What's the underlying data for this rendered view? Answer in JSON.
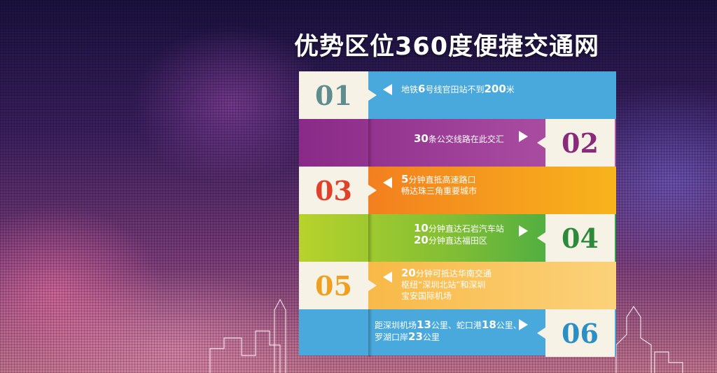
{
  "title": "优势区位360度便捷交通网",
  "rows": [
    {
      "num": "01",
      "num_color": "#5f8c8e",
      "lines": [
        [
          "地铁",
          "6",
          "号线官田站不到",
          "200",
          "米"
        ]
      ]
    },
    {
      "num": "02",
      "num_color": "#8a2a7a",
      "lines": [
        [
          "",
          "30",
          "条公交线路在此交汇"
        ]
      ]
    },
    {
      "num": "03",
      "num_color": "#e0412a",
      "lines": [
        [
          "",
          "5",
          "分钟直抵高速路口"
        ],
        [
          "畅达珠三角重要城市"
        ]
      ]
    },
    {
      "num": "04",
      "num_color": "#2d8a3a",
      "lines": [
        [
          "",
          "10",
          "分钟直达石岩汽车站"
        ],
        [
          "",
          "20",
          "分钟直达福田区"
        ]
      ]
    },
    {
      "num": "05",
      "num_color": "#f0a020",
      "lines": [
        [
          "",
          "20",
          "分钟可抵达华南交通"
        ],
        [
          "枢纽“深圳北站”和深圳"
        ],
        [
          "宝安国际机场"
        ]
      ]
    },
    {
      "num": "06",
      "num_color": "#2a8fc4",
      "lines": [
        [
          "距深圳机场",
          "13",
          "公里、蛇口港",
          "18",
          "公里、"
        ],
        [
          "罗湖口岸",
          "23",
          "公里"
        ]
      ]
    }
  ],
  "colors": {
    "blue": "#4aa9dc",
    "purple": "#9b3c93",
    "orange": "#f1701f",
    "green": "#7fbd35",
    "yellow": "#f8c55a",
    "cream": "#f6f3e6"
  }
}
